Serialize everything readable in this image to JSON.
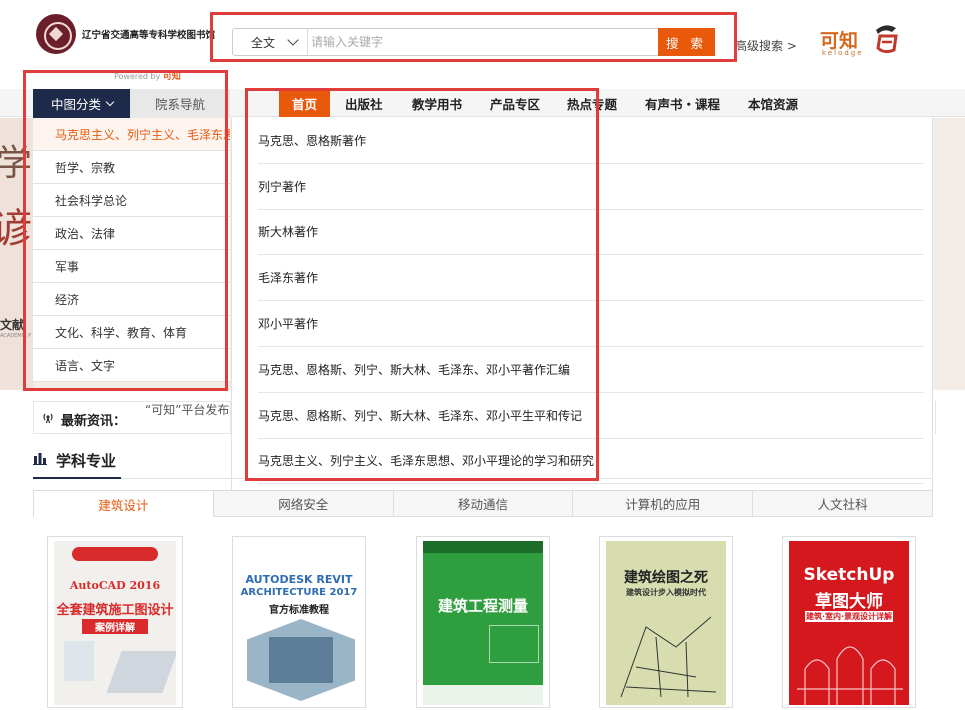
{
  "header": {
    "library_name": "辽宁省交通高等专科学校图书馆",
    "powered_by": "Powered by",
    "powered_brand": "可知",
    "brand_logo_text": "可知",
    "brand_logo_sub": "kelodge"
  },
  "search": {
    "scope": "全文",
    "placeholder": "请输入关键字",
    "button": "搜 索",
    "advanced": "高级搜索 >"
  },
  "nav": {
    "category_tab": "中图分类",
    "dept_tab": "院系导航",
    "items": [
      "首页",
      "出版社",
      "教学用书",
      "产品专区",
      "热点专题",
      "有声书・课程",
      "本馆资源"
    ]
  },
  "categories": [
    "马克思主义、列宁主义、毛泽东思想、邓小平理论",
    "哲学、宗教",
    "社会科学总论",
    "政治、法律",
    "军事",
    "经济",
    "文化、科学、教育、体育",
    "语言、文字"
  ],
  "subcategories": [
    "马克思、恩格斯著作",
    "列宁著作",
    "斯大林著作",
    "毛泽东著作",
    "邓小平著作",
    "马克思、恩格斯、列宁、斯大林、毛泽东、邓小平著作汇编",
    "马克思、恩格斯、列宁、斯大林、毛泽东、邓小平生平和传记",
    "马克思主义、列宁主义、毛泽东思想、邓小平理论的学习和研究"
  ],
  "banner": {
    "glyph_1": "学",
    "glyph_2": "谚",
    "caption": "文献",
    "caption_sub": "ACADEMIC P"
  },
  "news": {
    "label": "最新资讯：",
    "text": "“可知”平台发布"
  },
  "subjects": {
    "title": "学科专业",
    "tabs": [
      "建筑设计",
      "网络安全",
      "移动通信",
      "计算机的应用",
      "人文社科"
    ],
    "active_tab": 0
  },
  "books": [
    {
      "title": "全套建筑施工图设计",
      "subtitle": "AutoCAD 2016",
      "tag": "案例详解",
      "bg": "#f2f0ec",
      "accent": "#d92b2b"
    },
    {
      "title": "AUTODESK REVIT",
      "subtitle": "ARCHITECTURE 2017",
      "tag": "官方标准教程",
      "bg": "#ffffff",
      "accent": "#2f6db3"
    },
    {
      "title": "建筑工程测量",
      "subtitle": "",
      "tag": "",
      "bg": "#2f9e3e",
      "accent": "#ffffff"
    },
    {
      "title": "建筑绘图之死",
      "subtitle": "建筑设计步入模拟时代",
      "tag": "",
      "bg": "#d8ddb0",
      "accent": "#222222"
    },
    {
      "title": "SketchUp",
      "subtitle": "草图大师",
      "tag": "建筑·室内·景观设计详解",
      "bg": "#d4181e",
      "accent": "#ffffff"
    }
  ],
  "colors": {
    "accent_orange": "#e8590c",
    "nav_dark": "#1e2a4a",
    "annotation_red": "#e03c3c"
  }
}
